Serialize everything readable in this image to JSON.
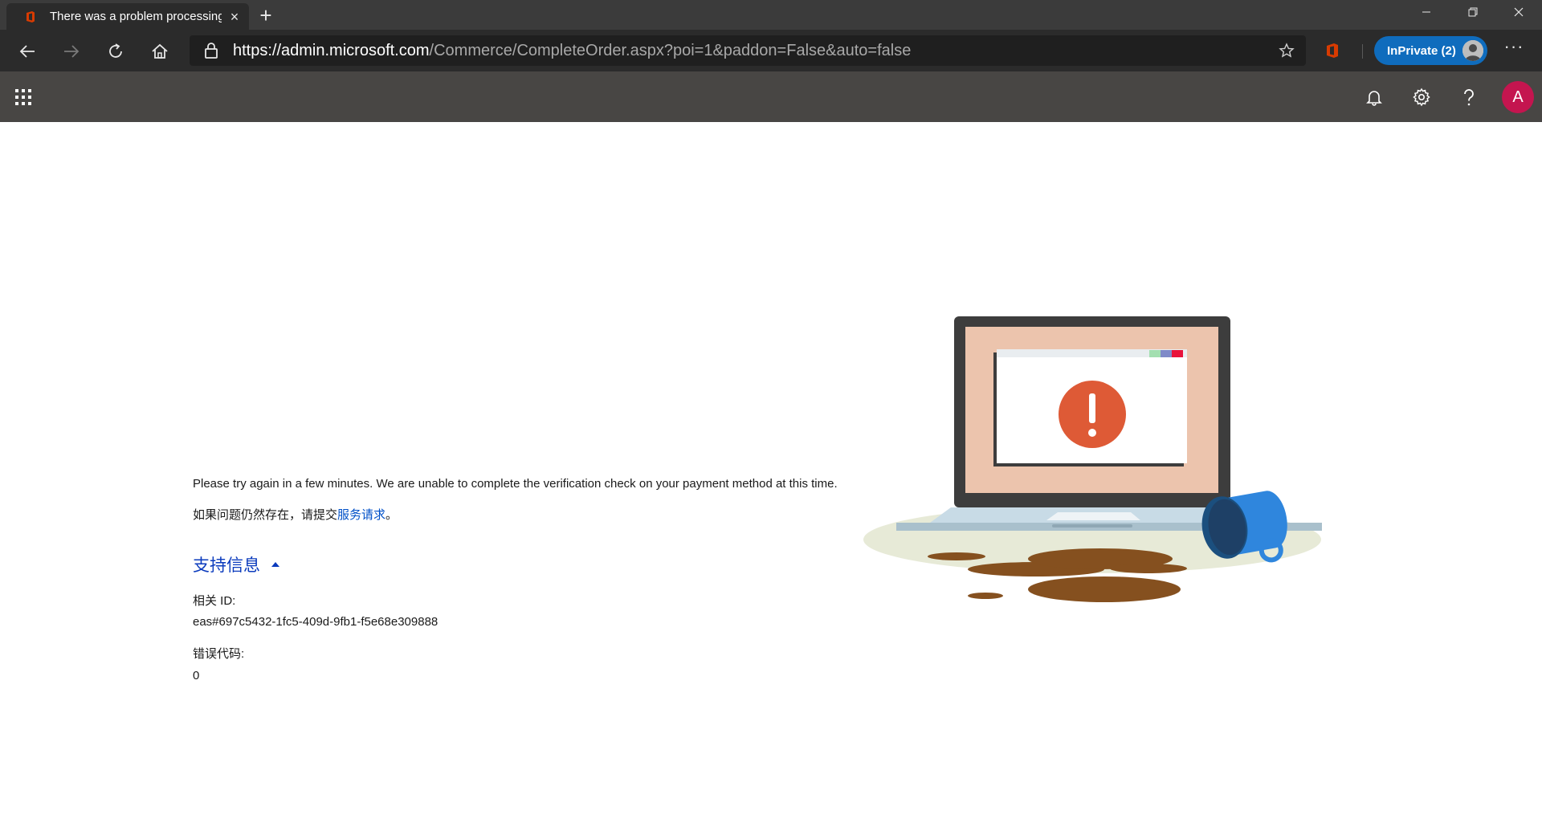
{
  "browser": {
    "tab_title": "There was a problem processing",
    "url_scheme_host": "https://admin.microsoft.com",
    "url_path": "/Commerce/CompleteOrder.aspx?poi=1&paddon=False&auto=false",
    "inprivate_label": "InPrivate (2)"
  },
  "app": {
    "user_initial": "A"
  },
  "error": {
    "message": "Please try again in a few minutes. We are unable to complete the verification check on your payment method at this time.",
    "persist_prefix": "如果问题仍然存在，请提交",
    "service_request_link": "服务请求",
    "persist_suffix": "。"
  },
  "support": {
    "heading": "支持信息",
    "correlation_label": "相关 ID:",
    "correlation_value": "eas#697c5432-1fc5-409d-9fb1-f5e68e309888",
    "error_code_label": "错误代码:",
    "error_code_value": "0"
  },
  "colors": {
    "brand_accent": "#0f6cbd",
    "app_header": "#484644",
    "avatar": "#c4154f",
    "link": "#0050c8"
  }
}
